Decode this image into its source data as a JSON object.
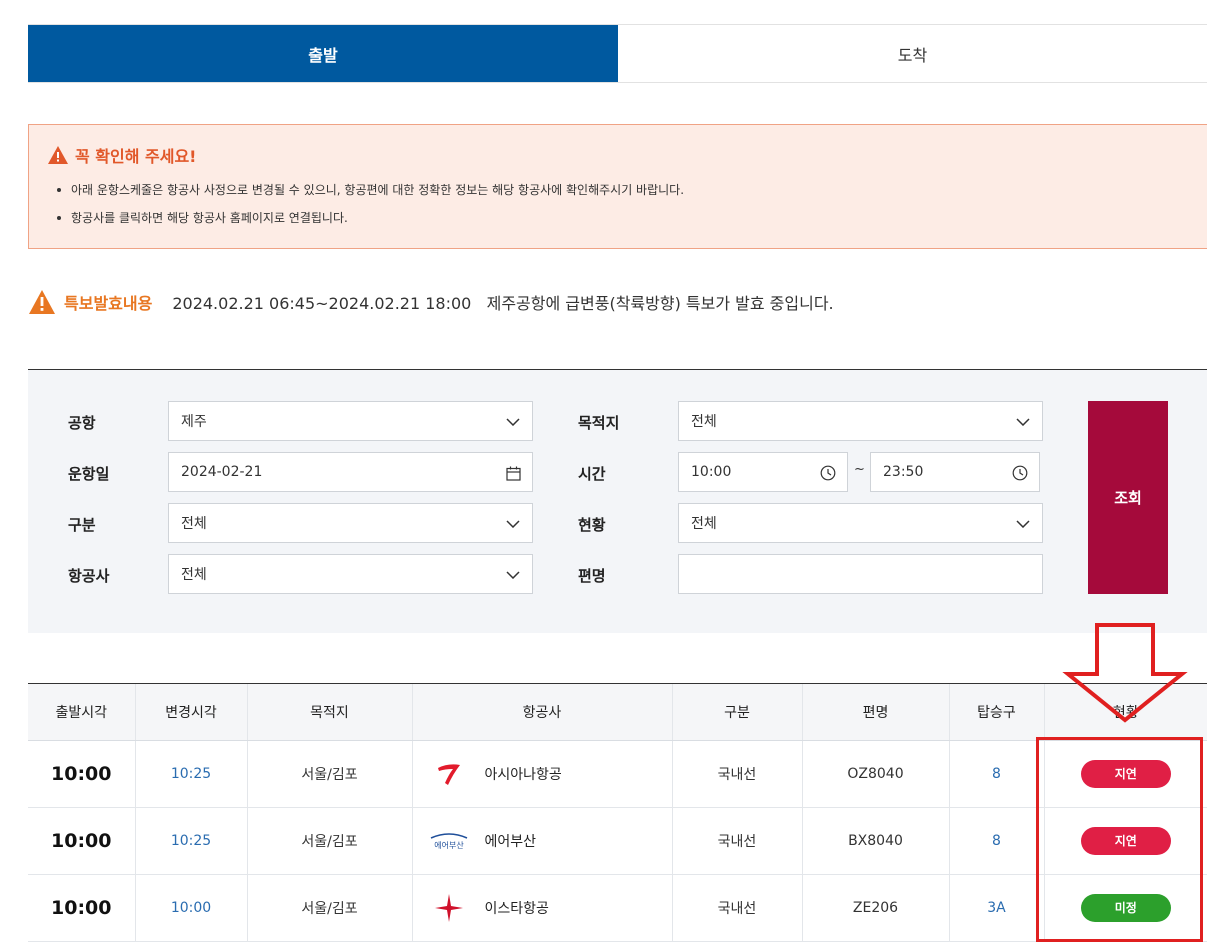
{
  "tabs": [
    {
      "label": "출발",
      "active": true
    },
    {
      "label": "도착",
      "active": false
    }
  ],
  "notice": {
    "title": "꼭 확인해 주세요!",
    "items": [
      "아래 운항스케줄은 항공사 사정으로 변경될 수 있으니, 항공편에 대한 정확한 정보는 해당 항공사에 확인해주시기 바랍니다.",
      "항공사를 클릭하면 해당 항공사 홈페이지로 연결됩니다."
    ]
  },
  "special": {
    "label": "특보발효내용",
    "text": "2024.02.21 06:45~2024.02.21 18:00   제주공항에 급변풍(착륙방향) 특보가 발효 중입니다."
  },
  "search": {
    "airport_label": "공항",
    "airport_value": "제주",
    "destination_label": "목적지",
    "destination_value": "전체",
    "date_label": "운항일",
    "date_value": "2024-02-21",
    "time_label": "시간",
    "time_from": "10:00",
    "time_sep": "~",
    "time_to": "23:50",
    "type_label": "구분",
    "type_value": "전체",
    "status_label": "현황",
    "status_value": "전체",
    "airline_label": "항공사",
    "airline_value": "전체",
    "flight_label": "편명",
    "flight_value": "",
    "submit_label": "조회"
  },
  "table": {
    "headers": [
      "출발시각",
      "변경시각",
      "목적지",
      "항공사",
      "구분",
      "편명",
      "탑승구",
      "현황"
    ],
    "rows": [
      {
        "time": "10:00",
        "changed": "10:25",
        "dest": "서울/김포",
        "airline": "아시아나항공",
        "logo": "asiana-logo",
        "type": "국내선",
        "flight": "OZ8040",
        "gate": "8",
        "status": "지연",
        "status_kind": "delay"
      },
      {
        "time": "10:00",
        "changed": "10:25",
        "dest": "서울/김포",
        "airline": "에어부산",
        "logo": "airbusan-logo",
        "logo_text": "에어부산",
        "type": "국내선",
        "flight": "BX8040",
        "gate": "8",
        "status": "지연",
        "status_kind": "delay"
      },
      {
        "time": "10:00",
        "changed": "10:00",
        "dest": "서울/김포",
        "airline": "이스타항공",
        "logo": "eastar-logo",
        "type": "국내선",
        "flight": "ZE206",
        "gate": "3A",
        "status": "미정",
        "status_kind": "tbd"
      }
    ]
  },
  "colors": {
    "tab_active": "#00599f",
    "notice_bg": "#fdece5",
    "notice_title": "#e1582a",
    "special_label": "#e87722",
    "search_button": "#a50a3b",
    "status_delay": "#e01f45",
    "status_tbd": "#2ca02c",
    "annotation": "#e02020"
  }
}
